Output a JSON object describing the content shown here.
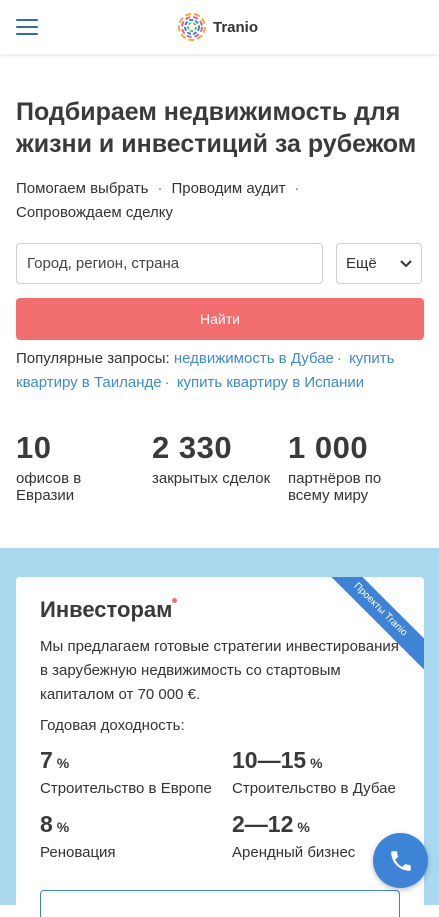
{
  "header": {
    "menu_icon": "burger-icon",
    "logo_text": "Tranio"
  },
  "hero": {
    "title": "Подбираем недвижимость для жизни и инвестиций за рубежом",
    "features": [
      "Помогаем выбрать",
      "Проводим аудит",
      "Сопровождаем сделку"
    ]
  },
  "search": {
    "placeholder": "Город, регион, страна",
    "select_value": "Ещё",
    "button_label": "Найти"
  },
  "popular": {
    "label": "Популярные запросы:",
    "links": [
      "недвижимость в Дубае",
      "купить квартиру в Таиланде",
      "купить квартиру в Испании"
    ]
  },
  "stats": [
    {
      "value": "10",
      "label_1": "офисов в",
      "label_2": "Евразии"
    },
    {
      "value": "2 330",
      "label_1": "закрытых сделок",
      "label_2": ""
    },
    {
      "value": "1 000",
      "label_1": "партнёров по",
      "label_2": "всему миру"
    }
  ],
  "investors": {
    "ribbon": "Проекты Tranio",
    "title": "Инвесторам",
    "description": "Мы предлагаем готовые стратегии инвестирования в зарубежную недвижимость со стартовым капиталом от 70 000 €.",
    "yield_label": "Годовая доходность:",
    "yields": [
      {
        "value": "7",
        "unit": "%",
        "name": "Строительство в Европе"
      },
      {
        "value": "10—15",
        "unit": "%",
        "name": "Строительство в Дубае"
      },
      {
        "value": "8",
        "unit": "%",
        "name": "Реновация"
      },
      {
        "value": "2—12",
        "unit": "%",
        "name": "Арендный бизнес"
      }
    ]
  },
  "colors": {
    "accent_blue": "#3d83d6",
    "link_blue": "#3f8ad0",
    "button_red": "#f26d6d",
    "section_bg": "#a9d8ef"
  }
}
